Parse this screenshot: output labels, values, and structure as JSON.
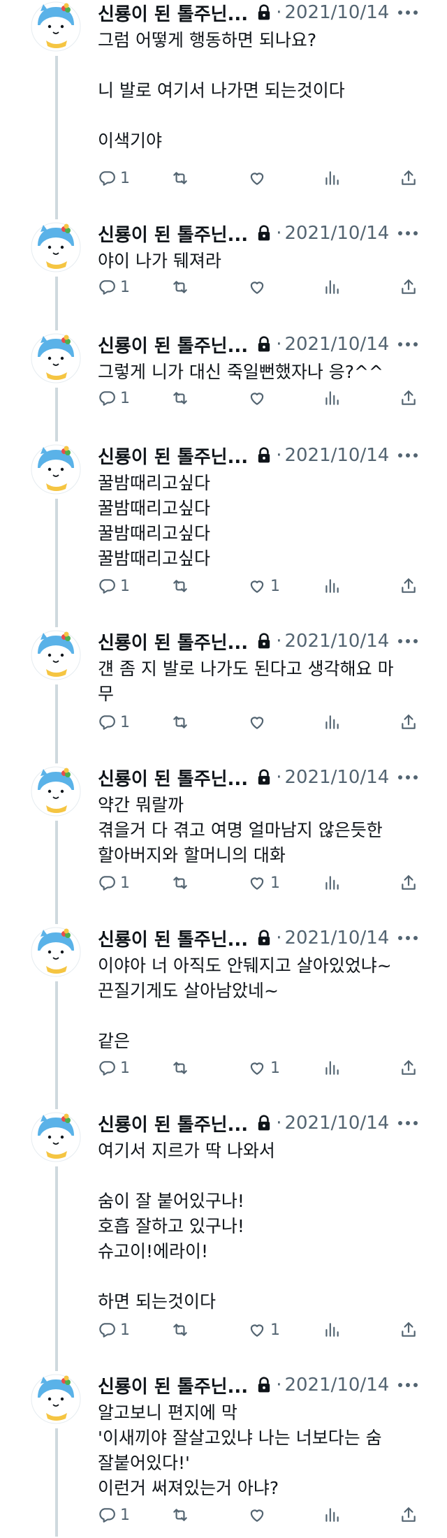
{
  "colors": {
    "text": "#0f1419",
    "muted": "#536471",
    "thread": "#cfd9de",
    "avatar_blue": "#5ab2e8",
    "avatar_scarf": "#f5c542"
  },
  "icons": [
    "avatar",
    "lock-icon",
    "more-icon",
    "reply-icon",
    "retweet-icon",
    "like-icon",
    "views-icon",
    "share-icon"
  ],
  "tweets": [
    {
      "name": "신룡이 된 톨주닌...",
      "sep": "·",
      "date": "2021/10/14",
      "lines": [
        "그럼 어떻게 행동하면 되나요?",
        "",
        "니 발로 여기서 나가면 되는것이다",
        "",
        "이색기야"
      ],
      "reply_count": "1",
      "like_count": ""
    },
    {
      "name": "신룡이 된 톨주닌...",
      "sep": "·",
      "date": "2021/10/14",
      "lines": [
        "야이 나가 뒈져라"
      ],
      "reply_count": "1",
      "like_count": ""
    },
    {
      "name": "신룡이 된 톨주닌...",
      "sep": "·",
      "date": "2021/10/14",
      "lines": [
        "그렇게 니가 대신 죽일뻔했자나 응?^^"
      ],
      "reply_count": "1",
      "like_count": ""
    },
    {
      "name": "신룡이 된 톨주닌...",
      "sep": "·",
      "date": "2021/10/14",
      "lines": [
        "꿀밤때리고싶다",
        "꿀밤때리고싶다",
        "꿀밤때리고싶다",
        "꿀밤때리고싶다"
      ],
      "reply_count": "1",
      "like_count": "1"
    },
    {
      "name": "신룡이 된 톨주닌...",
      "sep": "·",
      "date": "2021/10/14",
      "lines": [
        "걘 좀 지 발로 나가도 된다고 생각해요 마",
        "무"
      ],
      "reply_count": "1",
      "like_count": ""
    },
    {
      "name": "신룡이 된 톨주닌...",
      "sep": "·",
      "date": "2021/10/14",
      "lines": [
        "약간 뭐랄까",
        "겪을거 다 겪고 여명 얼마남지 않은듯한",
        "할아버지와 할머니의 대화"
      ],
      "reply_count": "1",
      "like_count": "1"
    },
    {
      "name": "신룡이 된 톨주닌...",
      "sep": "·",
      "date": "2021/10/14",
      "lines": [
        "이야아 너 아직도 안뒈지고 살아있었냐~",
        "끈질기게도 살아남았네~",
        "",
        "같은"
      ],
      "reply_count": "1",
      "like_count": "1"
    },
    {
      "name": "신룡이 된 톨주닌...",
      "sep": "·",
      "date": "2021/10/14",
      "lines": [
        "여기서 지르가 딱 나와서",
        "",
        "숨이 잘 붙어있구나!",
        "호흡 잘하고 있구나!",
        "슈고이!에라이!",
        "",
        "하면 되는것이다"
      ],
      "reply_count": "1",
      "like_count": "1"
    },
    {
      "name": "신룡이 된 톨주닌...",
      "sep": "·",
      "date": "2021/10/14",
      "lines": [
        "알고보니 편지에 막",
        "'이새끼야 잘살고있냐 나는 너보다는 숨",
        "잘붙어있다!'",
        "이런거 써져있는거 아냐?"
      ],
      "reply_count": "1",
      "like_count": ""
    }
  ]
}
